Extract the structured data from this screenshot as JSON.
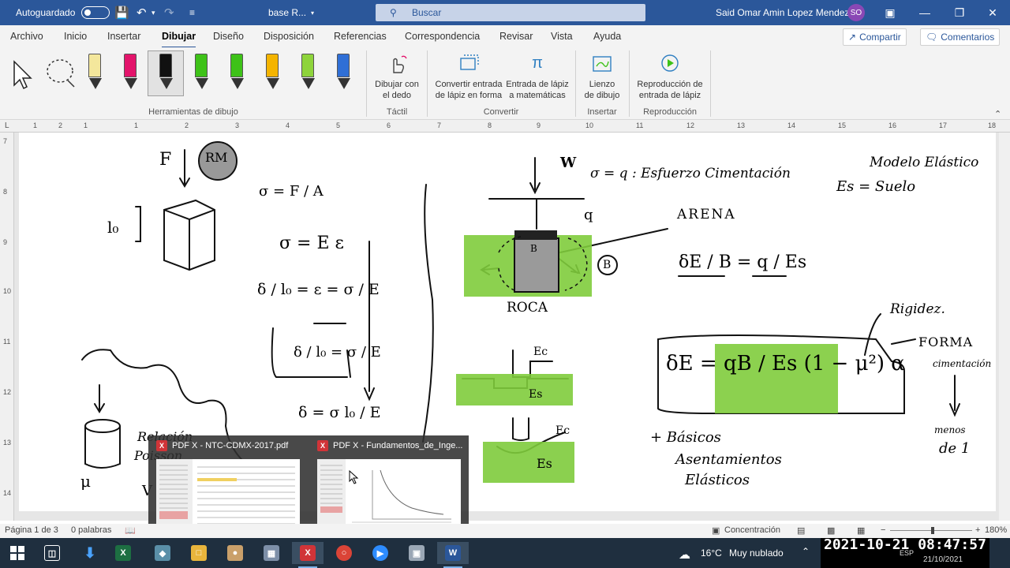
{
  "titlebar": {
    "autosave_label": "Autoguardado",
    "doc_name": "base R...",
    "search_placeholder": "Buscar",
    "user_name": "Said Omar Amin Lopez Mendez",
    "user_initials": "SO"
  },
  "tabs": [
    "Archivo",
    "Inicio",
    "Insertar",
    "Dibujar",
    "Diseño",
    "Disposición",
    "Referencias",
    "Correspondencia",
    "Revisar",
    "Vista",
    "Ayuda"
  ],
  "active_tab": "Dibujar",
  "share": {
    "share_label": "Compartir",
    "comments_label": "Comentarios"
  },
  "ribbon": {
    "pen_colors": [
      "#f4e79c",
      "#e3146b",
      "#111111",
      "#3ec218",
      "#3ec218",
      "#f4b400",
      "#8ed43b",
      "#2f6fd6"
    ],
    "touch_label_1": "Dibujar con",
    "touch_label_2": "el dedo",
    "ink_shape_1": "Convertir entrada",
    "ink_shape_2": "de lápiz en forma",
    "ink_math_1": "Entrada de lápiz",
    "ink_math_2": "a matemáticas",
    "canvas_1": "Lienzo",
    "canvas_2": "de dibujo",
    "replay_1": "Reproducción de",
    "replay_2": "entrada de lápiz",
    "groups": {
      "tools": "Herramientas de dibujo",
      "touch": "Táctil",
      "convert": "Convertir",
      "insert": "Insertar",
      "replay": "Reproducción"
    }
  },
  "ruler": {
    "h": [
      "1",
      "2",
      "1",
      "1",
      "2",
      "3",
      "4",
      "5",
      "6",
      "7",
      "8",
      "9",
      "10",
      "11",
      "12",
      "13",
      "14",
      "15",
      "16",
      "17",
      "18",
      "19"
    ],
    "v": [
      "7",
      "8",
      "9",
      "10",
      "11",
      "12",
      "13",
      "14"
    ]
  },
  "notes": {
    "f": "F",
    "rm": "RM",
    "l0": "l₀",
    "sigma_fa": "σ = F / A",
    "sigma_ee": "σ = E ε",
    "strain_1": "δ / l₀ = ε = σ / E",
    "strain_2": "δ / l₀ = σ / E",
    "delta_eq": "δ = σ l₀ / E",
    "w": "W",
    "q_label": "q",
    "q_eq": "σ = q : Esfuerzo Cimentación",
    "arena": "ARENA",
    "roca": "ROCA",
    "b_circle": "B",
    "b_small": "B",
    "modelo": "Modelo Elástico",
    "es_suelo": "Es = Suelo",
    "de_b": "δE / B = q / Es",
    "ec1": "Ec",
    "es1": "Es",
    "ec2": "Ec",
    "es2": "Es",
    "rigidez": "Rigidez.",
    "forma": "FORMA",
    "cimentacion": "cimentación",
    "menos": "menos",
    "de1": "de 1",
    "basicos": "+ Básicos",
    "asentamientos": "Asentamientos",
    "elasticos": "Elásticos",
    "relacion": "Relación",
    "poisson": "Poisson",
    "mu": "μ",
    "v": "V",
    "main_eq": "δE = qB / Es (1 − μ²) α"
  },
  "thumbs": [
    {
      "title": "PDF X - NTC-CDMX-2017.pdf"
    },
    {
      "title": "PDF X - Fundamentos_de_Inge..."
    }
  ],
  "status": {
    "page": "Página 1 de 3",
    "words": "0 palabras",
    "focus": "Concentración",
    "zoom": "180%"
  },
  "taskbar": {
    "weather_temp": "16°C",
    "weather_desc": "Muy nublado",
    "lang": "ESP",
    "timestamp": "2021-10-21  08:47:57",
    "sys_date": "21/10/2021"
  }
}
